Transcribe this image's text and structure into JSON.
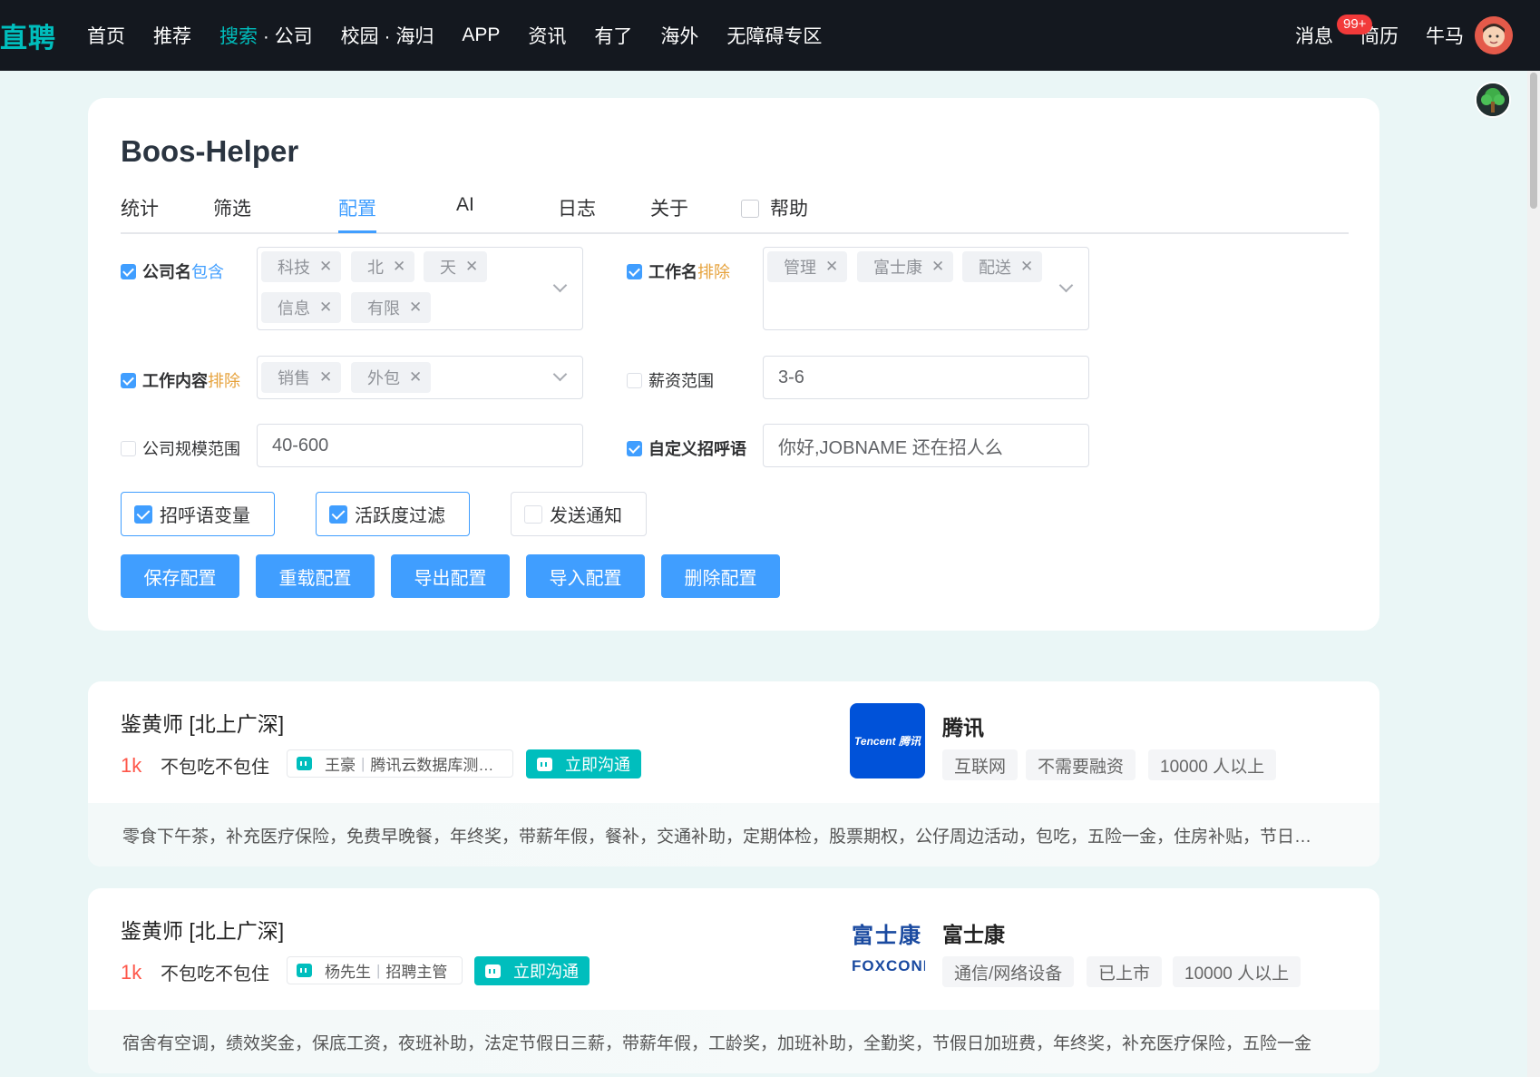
{
  "nav": {
    "logo": "直聘",
    "items": [
      "首页",
      "推荐"
    ],
    "search_hl": "搜索",
    "search_rest": " · 公司",
    "items2": [
      "校园 · 海归",
      "APP",
      "资讯",
      "有了",
      "海外",
      "无障碍专区"
    ],
    "right": {
      "messages": "消息",
      "badge": "99+",
      "resume": "简历",
      "user": "牛马"
    }
  },
  "helper": {
    "title": "Boos-Helper",
    "tabs": [
      "统计",
      "筛选",
      "配置",
      "AI",
      "日志",
      "关于"
    ],
    "help_tab": "帮助",
    "fields": {
      "company_name": {
        "label": "公司名",
        "mode": "包含",
        "tags": [
          "科技",
          "北",
          "天",
          "信息",
          "有限"
        ]
      },
      "job_name": {
        "label": "工作名",
        "mode": "排除",
        "tags": [
          "管理",
          "富士康",
          "配送"
        ]
      },
      "job_content": {
        "label": "工作内容",
        "mode": "排除",
        "tags": [
          "销售",
          "外包"
        ]
      },
      "salary_range": {
        "label": "薪资范围",
        "value": "3-6"
      },
      "company_scale": {
        "label": "公司规模范围",
        "value": "40-600"
      },
      "greeting": {
        "label": "自定义招呼语",
        "value": "你好,JOBNAME 还在招人么"
      }
    },
    "toggles": [
      "招呼语变量",
      "活跃度过滤",
      "发送通知"
    ],
    "buttons": [
      "保存配置",
      "重载配置",
      "导出配置",
      "导入配置",
      "删除配置"
    ],
    "close": "×"
  },
  "jobs": [
    {
      "title": "鉴黄师 [北上广深]",
      "salary": "1k",
      "perk": "不包吃不包住",
      "recruiter_name": "王豪",
      "recruiter_role": "腾讯云数据库测…",
      "chat": "立即沟通",
      "company": "腾讯",
      "logo_text": "Tencent 腾讯",
      "company_tags": [
        "互联网",
        "不需要融资",
        "10000 人以上"
      ],
      "benefits": "零食下午茶，补充医疗保险，免费早晚餐，年终奖，带薪年假，餐补，交通补助，定期体检，股票期权，公仔周边活动，包吃，五险一金，住房补贴，节日…"
    },
    {
      "title": "鉴黄师 [北上广深]",
      "salary": "1k",
      "perk": "不包吃不包住",
      "recruiter_name": "杨先生",
      "recruiter_role": "招聘主管",
      "chat": "立即沟通",
      "company": "富士康",
      "logo_text_top": "富士康",
      "logo_text_bottom": "FOXCONN",
      "company_tags": [
        "通信/网络设备",
        "已上市",
        "10000 人以上"
      ],
      "benefits": "宿舍有空调，绩效奖金，保底工资，夜班补助，法定节假日三薪，带薪年假，工龄奖，加班补助，全勤奖，节假日加班费，年终奖，补充医疗保险，五险一金"
    }
  ]
}
